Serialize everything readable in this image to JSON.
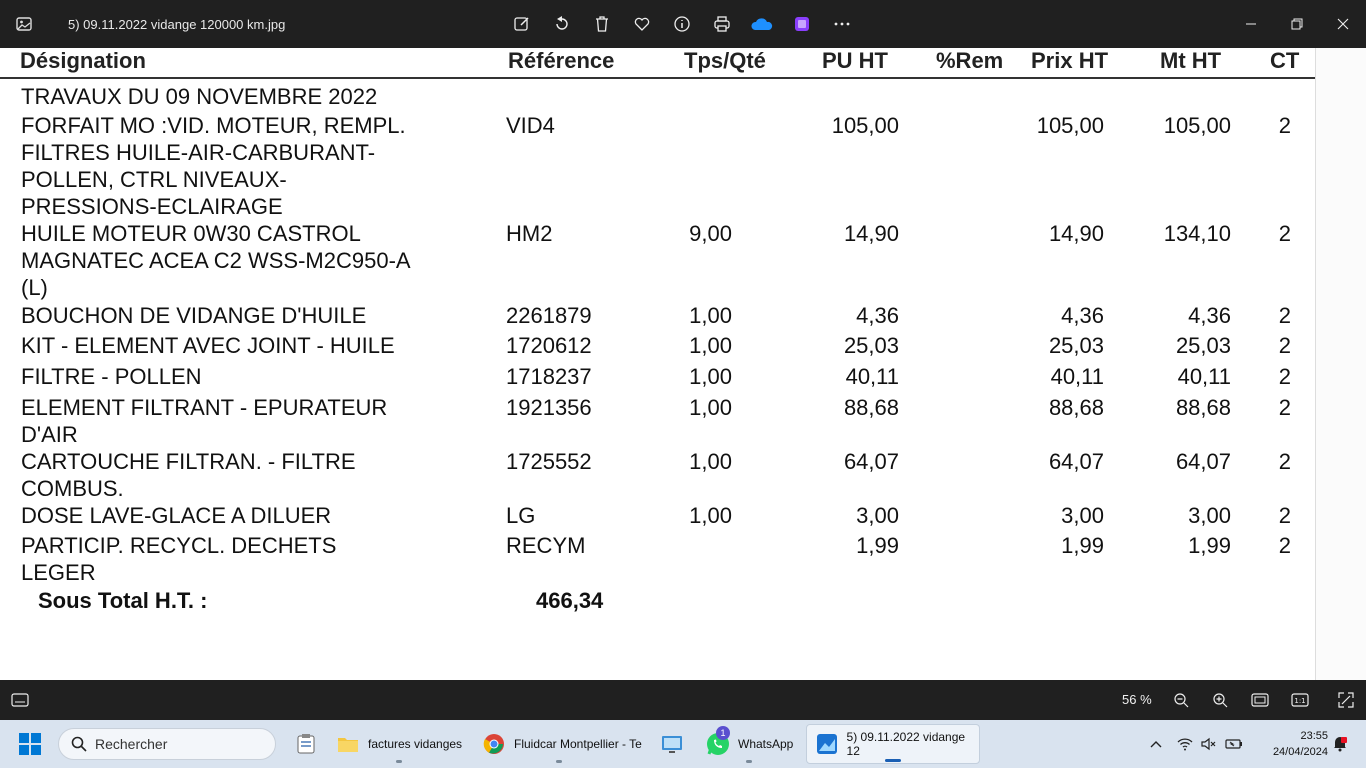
{
  "window": {
    "title": "5) 09.11.2022 vidange 120000 km.jpg"
  },
  "toolbar": {
    "icons": [
      "edit-icon",
      "rotate-icon",
      "delete-icon",
      "favorite-icon",
      "info-icon",
      "print-icon",
      "onedrive-icon",
      "clipchamp-icon",
      "more-icon"
    ]
  },
  "document": {
    "headers": {
      "designation": "Désignation",
      "reference": "Référence",
      "tps_qte": "Tps/Qté",
      "pu_ht": "PU HT",
      "rem": "%Rem",
      "prix_ht": "Prix HT",
      "mt_ht": "Mt HT",
      "ct": "CT"
    },
    "section_title": "TRAVAUX DU 09 NOVEMBRE 2022",
    "rows": [
      {
        "lines": [
          "FORFAIT MO :VID. MOTEUR, REMPL.",
          "FILTRES HUILE-AIR-CARBURANT-",
          "POLLEN, CTRL NIVEAUX-",
          "PRESSIONS-ECLAIRAGE"
        ],
        "ref": "VID4",
        "qty": "",
        "pu": "105,00",
        "prix": "105,00",
        "mt": "105,00",
        "ct": "2"
      },
      {
        "lines": [
          "HUILE MOTEUR 0W30 CASTROL",
          "MAGNATEC ACEA C2 WSS-M2C950-A",
          "(L)"
        ],
        "ref": "HM2",
        "qty": "9,00",
        "pu": "14,90",
        "prix": "14,90",
        "mt": "134,10",
        "ct": "2"
      },
      {
        "lines": [
          "BOUCHON DE VIDANGE D'HUILE"
        ],
        "ref": "2261879",
        "qty": "1,00",
        "pu": "4,36",
        "prix": "4,36",
        "mt": "4,36",
        "ct": "2"
      },
      {
        "lines": [
          "KIT - ELEMENT AVEC JOINT - HUILE"
        ],
        "ref": "1720612",
        "qty": "1,00",
        "pu": "25,03",
        "prix": "25,03",
        "mt": "25,03",
        "ct": "2"
      },
      {
        "lines": [
          "FILTRE - POLLEN"
        ],
        "ref": "1718237",
        "qty": "1,00",
        "pu": "40,11",
        "prix": "40,11",
        "mt": "40,11",
        "ct": "2"
      },
      {
        "lines": [
          "ELEMENT FILTRANT - EPURATEUR",
          "D'AIR"
        ],
        "ref": "1921356",
        "qty": "1,00",
        "pu": "88,68",
        "prix": "88,68",
        "mt": "88,68",
        "ct": "2"
      },
      {
        "lines": [
          "CARTOUCHE FILTRAN. - FILTRE",
          "COMBUS."
        ],
        "ref": "1725552",
        "qty": "1,00",
        "pu": "64,07",
        "prix": "64,07",
        "mt": "64,07",
        "ct": "2"
      },
      {
        "lines": [
          "DOSE LAVE-GLACE A DILUER"
        ],
        "ref": "LG",
        "qty": "1,00",
        "pu": "3,00",
        "prix": "3,00",
        "mt": "3,00",
        "ct": "2"
      },
      {
        "lines": [
          "PARTICIP. RECYCL. DECHETS",
          "LEGER"
        ],
        "ref": "RECYM",
        "qty": "",
        "pu": "1,99",
        "prix": "1,99",
        "mt": "1,99",
        "ct": "2"
      }
    ],
    "subtotal_label": "Sous Total H.T. :",
    "subtotal_value": "466,34"
  },
  "statusbar": {
    "zoom": "56 %"
  },
  "taskbar": {
    "search_placeholder": "Rechercher",
    "items": [
      {
        "label": "factures vidanges"
      },
      {
        "label": "Fluidcar Montpellier - Te"
      },
      {
        "label": "WhatsApp",
        "badge": "1"
      },
      {
        "label": "5) 09.11.2022 vidange 12"
      }
    ],
    "time": "23:55",
    "date": "24/04/2024"
  },
  "colors": {
    "titlebar": "#202020",
    "taskbar": "#d9e3ef",
    "accent": "#1a5fb4"
  }
}
